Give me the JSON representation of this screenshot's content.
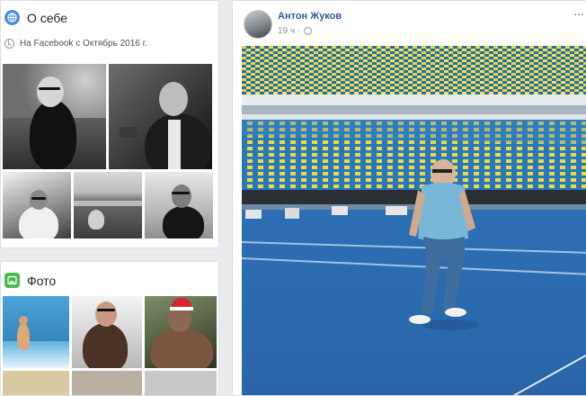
{
  "about": {
    "title": "О себе",
    "icon": "globe-icon",
    "since": "На Facebook с Октябрь 2016 г."
  },
  "photos": {
    "title": "Фото",
    "icon": "photo-icon"
  },
  "post": {
    "author": "Антон Жуков",
    "time": "19 ч",
    "dot": "·",
    "more": "···",
    "privacy_icon": "globe-icon"
  },
  "colors": {
    "link": "#365899",
    "about_icon": "#4c8de0",
    "photos_icon": "#4bb84f",
    "page_bg": "#e9ebee"
  }
}
